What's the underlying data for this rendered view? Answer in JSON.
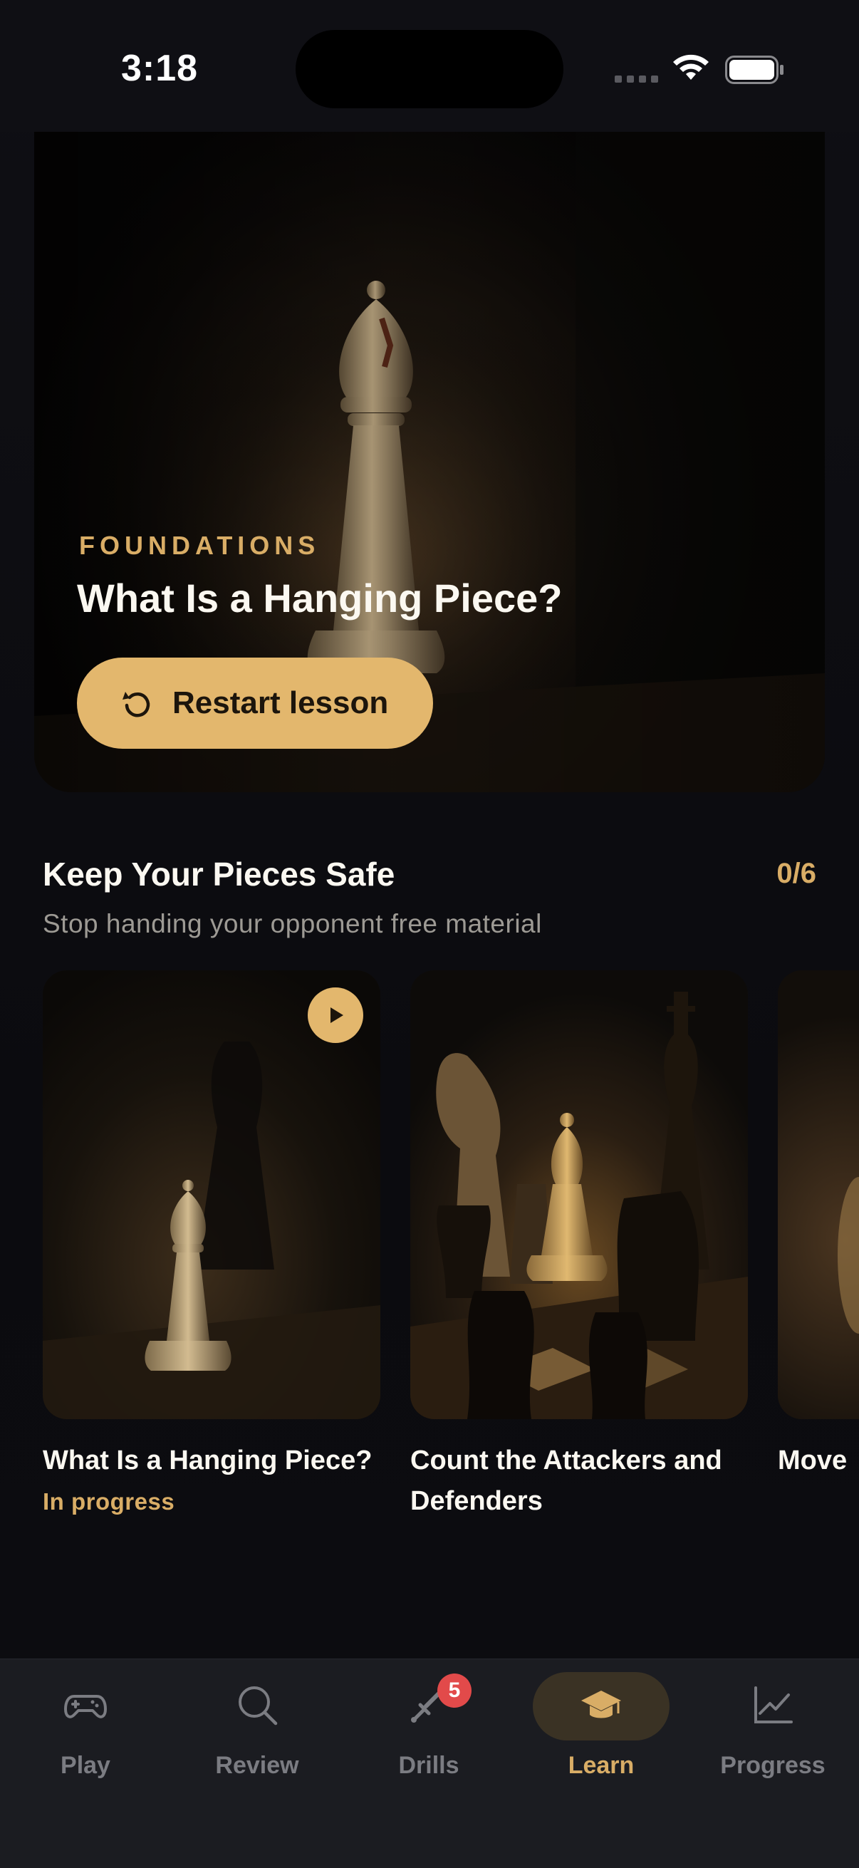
{
  "status_bar": {
    "time": "3:18"
  },
  "hero": {
    "eyebrow": "FOUNDATIONS",
    "title": "What Is a Hanging Piece?",
    "button_label": "Restart lesson",
    "accent": "#e3b76d"
  },
  "section": {
    "title": "Keep Your Pieces Safe",
    "subtitle": "Stop handing your opponent free material",
    "progress": "0/6"
  },
  "lessons": [
    {
      "title": "What Is a Hanging Piece?",
      "status": "In progress",
      "has_play": true
    },
    {
      "title": "Count the Attackers and Defenders",
      "status": "",
      "has_play": false
    },
    {
      "title": "Move",
      "status": "",
      "has_play": false
    }
  ],
  "nav": {
    "items": [
      {
        "label": "Play",
        "icon": "gamepad-icon"
      },
      {
        "label": "Review",
        "icon": "search-icon"
      },
      {
        "label": "Drills",
        "icon": "sword-icon",
        "badge": "5"
      },
      {
        "label": "Learn",
        "icon": "graduation-cap-icon",
        "active": true
      },
      {
        "label": "Progress",
        "icon": "chart-line-icon"
      }
    ]
  },
  "colors": {
    "background": "#0c0c10",
    "accent": "#d9ad66",
    "badge": "#e24a4a",
    "nav_bg": "#1b1c21"
  }
}
